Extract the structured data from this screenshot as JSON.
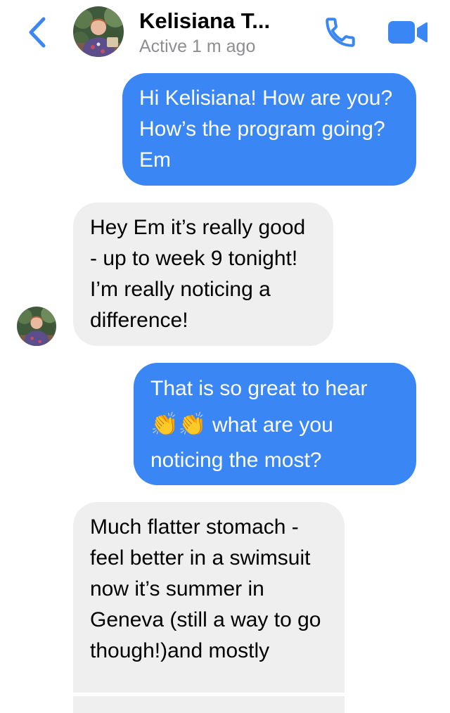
{
  "header": {
    "contact_name": "Kelisiana T...",
    "status": "Active 1 m ago",
    "back_icon": "chevron-left-icon",
    "call_icon": "phone-icon",
    "video_icon": "video-camera-icon"
  },
  "colors": {
    "accent": "#3a86f5",
    "outgoing_bubble": "#3a86f5",
    "incoming_bubble": "#efefef",
    "status_text": "#8e8e93"
  },
  "messages": [
    {
      "direction": "outgoing",
      "text": "Hi Kelisiana! How are you? How’s the program going? Em"
    },
    {
      "direction": "incoming",
      "text": "Hey Em it’s really good - up to week 9 tonight! I’m really noticing a difference!"
    },
    {
      "direction": "outgoing",
      "text_before_emoji": "That is so great to hear",
      "emoji": "👏👏",
      "text_after_emoji": "what are you noticing the most?"
    },
    {
      "direction": "incoming",
      "text": "Much flatter stomach - feel better in a swimsuit now it’s summer in Geneva (still a way to go though!)and mostly"
    }
  ]
}
